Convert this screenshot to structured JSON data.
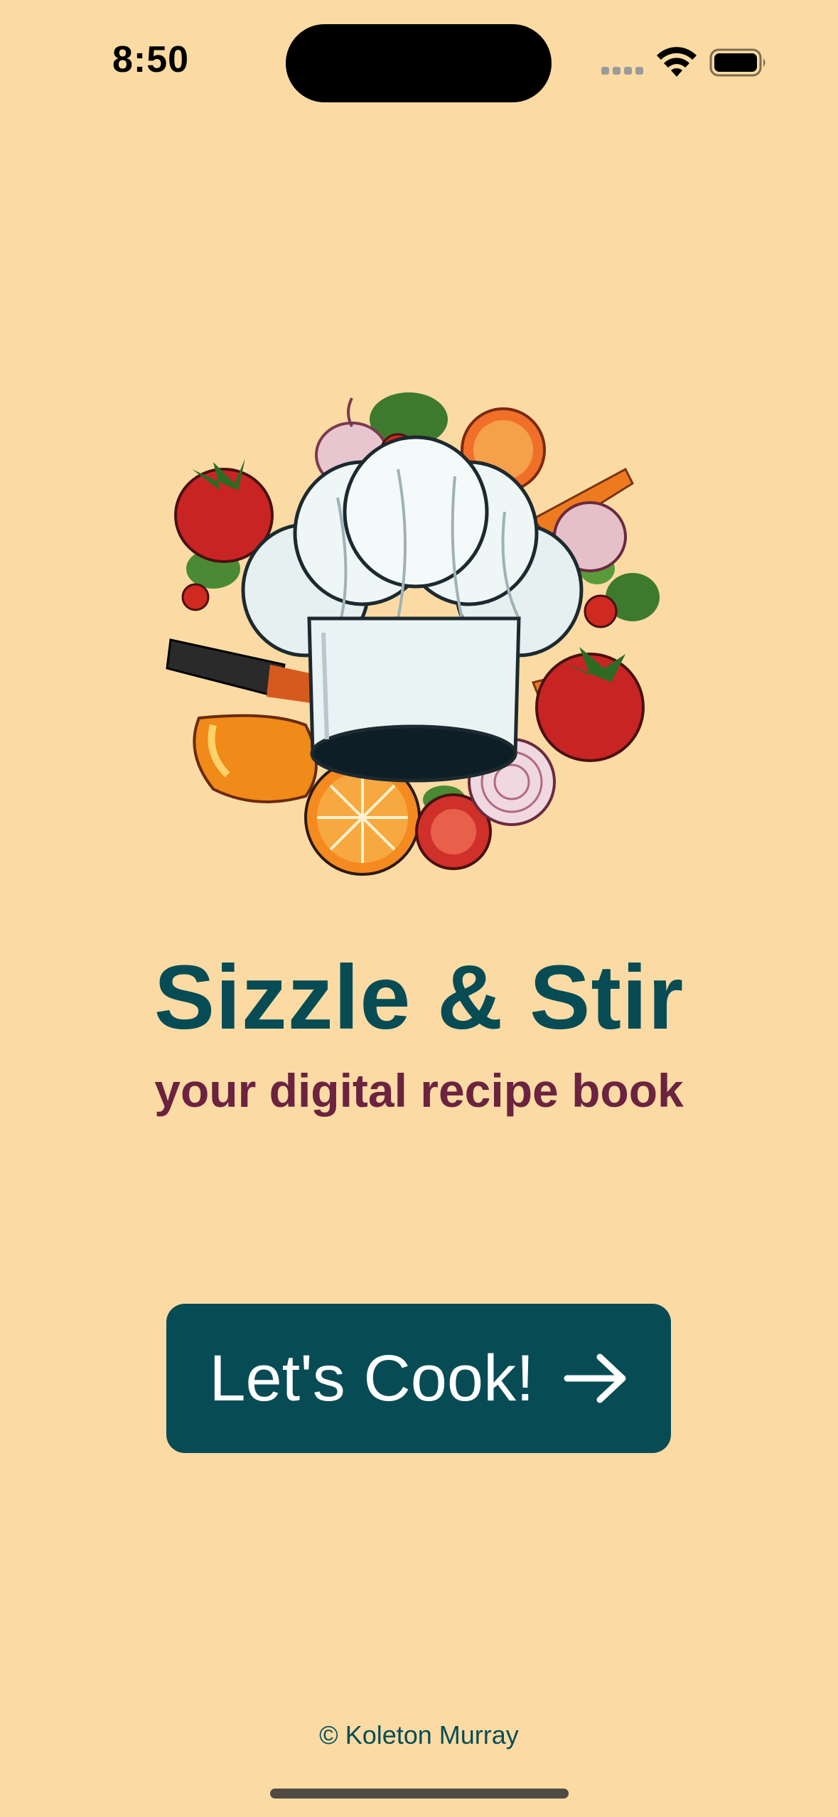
{
  "status_bar": {
    "time": "8:50",
    "signal_icon": "cellular-signal-icon",
    "wifi_icon": "wifi-icon",
    "battery_icon": "battery-icon"
  },
  "logo": {
    "icon": "chef-hat-vegetables-logo"
  },
  "app": {
    "title": "Sizzle & Stir",
    "subtitle": "your digital recipe book"
  },
  "cta": {
    "label": "Let's Cook!",
    "icon": "arrow-right-icon"
  },
  "footer": {
    "credit": "© Koleton Murray"
  },
  "colors": {
    "background": "#FBDBA3",
    "primary": "#074C55",
    "subtitle": "#6B2340",
    "button_text": "#FFFFFF"
  }
}
